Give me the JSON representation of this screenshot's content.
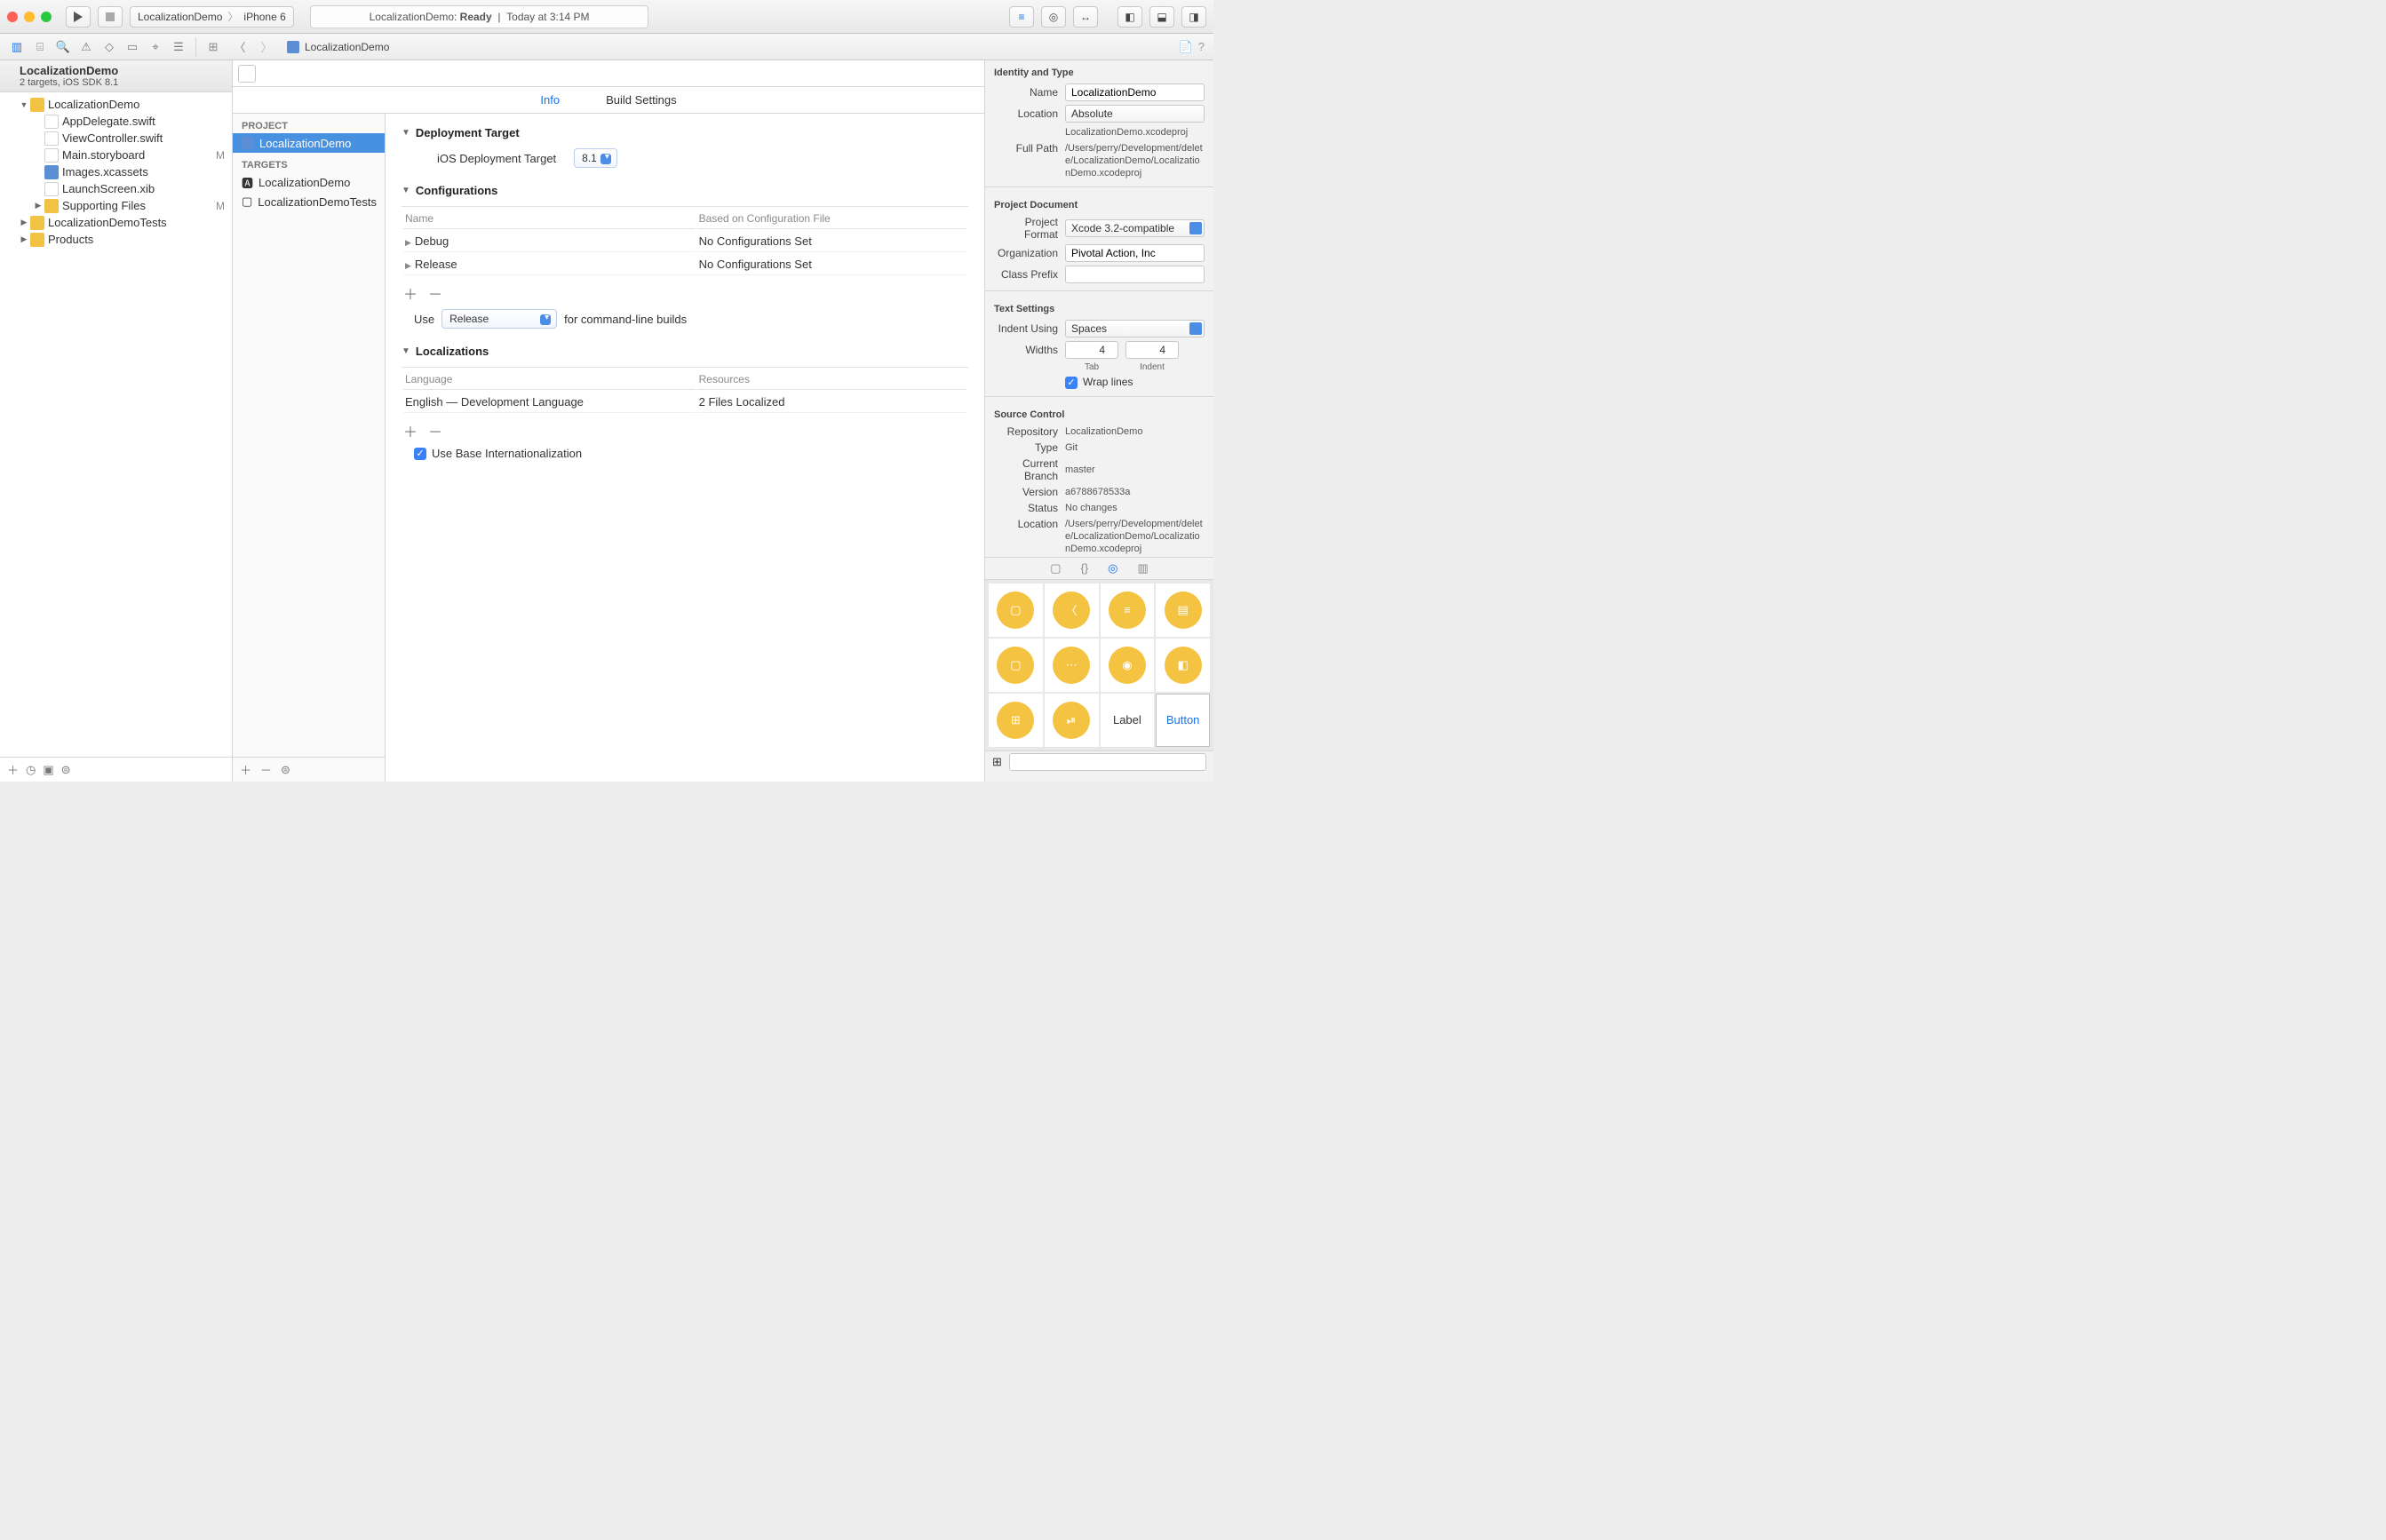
{
  "titlebar": {
    "scheme": "LocalizationDemo",
    "device": "iPhone 6",
    "activity": "LocalizationDemo:",
    "activity_status": "Ready",
    "activity_time": "Today at 3:14 PM"
  },
  "pathbar": {
    "file": "LocalizationDemo"
  },
  "navigator": {
    "project_title": "LocalizationDemo",
    "project_sub": "2 targets, iOS SDK 8.1",
    "items": [
      {
        "name": "LocalizationDemo",
        "kind": "folder",
        "depth": 1,
        "open": true
      },
      {
        "name": "AppDelegate.swift",
        "kind": "swift",
        "depth": 2
      },
      {
        "name": "ViewController.swift",
        "kind": "swift",
        "depth": 2
      },
      {
        "name": "Main.storyboard",
        "kind": "sb",
        "depth": 2,
        "flag": "M"
      },
      {
        "name": "Images.xcassets",
        "kind": "assets",
        "depth": 2
      },
      {
        "name": "LaunchScreen.xib",
        "kind": "xib",
        "depth": 2
      },
      {
        "name": "Supporting Files",
        "kind": "folder",
        "depth": 2,
        "closed": true,
        "flag": "M"
      },
      {
        "name": "LocalizationDemoTests",
        "kind": "folder",
        "depth": 1,
        "closed": true
      },
      {
        "name": "Products",
        "kind": "folder",
        "depth": 1,
        "closed": true
      }
    ]
  },
  "sourcelist": {
    "project_header": "PROJECT",
    "project_item": "LocalizationDemo",
    "targets_header": "TARGETS",
    "targets": [
      "LocalizationDemo",
      "LocalizationDemoTests"
    ]
  },
  "tabs": {
    "info": "Info",
    "build": "Build Settings"
  },
  "editor": {
    "deploy_section": "Deployment Target",
    "deploy_label": "iOS Deployment Target",
    "deploy_value": "8.1",
    "config_section": "Configurations",
    "config_name_header": "Name",
    "config_based_header": "Based on Configuration File",
    "configs": [
      {
        "name": "Debug",
        "based": "No Configurations Set"
      },
      {
        "name": "Release",
        "based": "No Configurations Set"
      }
    ],
    "use_label": "Use",
    "use_value": "Release",
    "use_tail": "for command-line builds",
    "loc_section": "Localizations",
    "loc_lang_header": "Language",
    "loc_res_header": "Resources",
    "locs": [
      {
        "lang": "English — Development Language",
        "res": "2 Files Localized"
      }
    ],
    "base_check": "Use Base Internationalization"
  },
  "inspector": {
    "identity_title": "Identity and Type",
    "name_label": "Name",
    "name_value": "LocalizationDemo",
    "location_label": "Location",
    "location_value": "Absolute",
    "location_file": "LocalizationDemo.xcodeproj",
    "fullpath_label": "Full Path",
    "fullpath_value": "/Users/perry/Development/delete/LocalizationDemo/LocalizationDemo.xcodeproj",
    "projdoc_title": "Project Document",
    "projfmt_label": "Project Format",
    "projfmt_value": "Xcode 3.2-compatible",
    "org_label": "Organization",
    "org_value": "Pivotal Action, Inc",
    "prefix_label": "Class Prefix",
    "prefix_value": "",
    "text_title": "Text Settings",
    "indent_label": "Indent Using",
    "indent_value": "Spaces",
    "widths_label": "Widths",
    "tab_width": "4",
    "indent_width": "4",
    "tab_caption": "Tab",
    "indent_caption": "Indent",
    "wrap_label": "Wrap lines",
    "sc_title": "Source Control",
    "repo_label": "Repository",
    "repo_value": "LocalizationDemo",
    "type_label": "Type",
    "type_value": "Git",
    "branch_label": "Current Branch",
    "branch_value": "master",
    "version_label": "Version",
    "version_value": "a6788678533a",
    "status_label": "Status",
    "status_value": "No changes",
    "scloc_label": "Location",
    "scloc_value": "/Users/perry/Development/delete/LocalizationDemo/LocalizationDemo.xcodeproj",
    "lib_label": "Label",
    "lib_button": "Button"
  }
}
